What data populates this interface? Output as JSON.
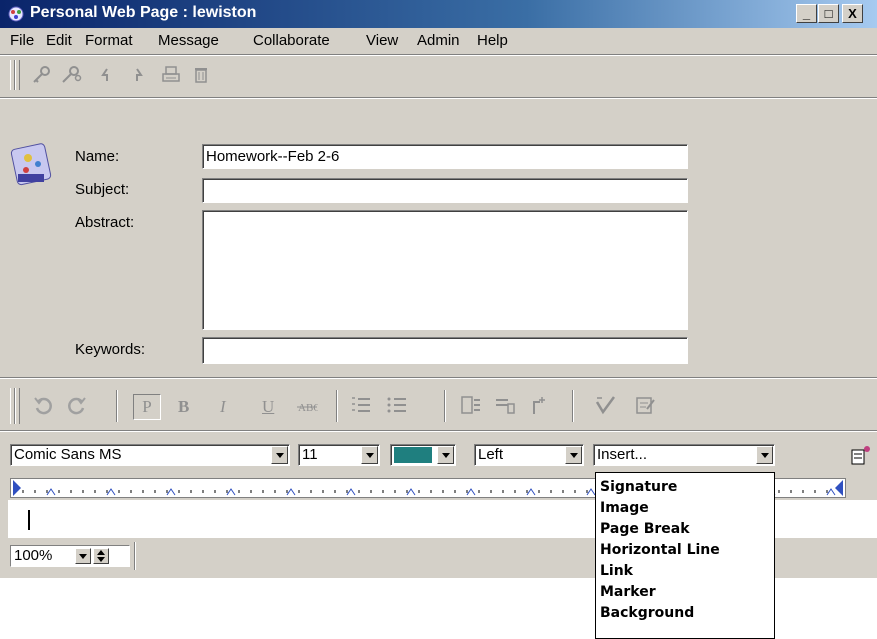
{
  "window": {
    "title": "Personal Web Page : lewiston",
    "min_label": "_",
    "max_label": "□",
    "close_label": "X"
  },
  "menu": [
    "File",
    "Edit",
    "Format",
    "Message",
    "Collaborate",
    "View",
    "Admin",
    "Help"
  ],
  "form": {
    "name_label": "Name:",
    "name_value": "Homework--Feb 2-6",
    "subject_label": "Subject:",
    "subject_value": "",
    "abstract_label": "Abstract:",
    "abstract_value": "",
    "keywords_label": "Keywords:",
    "keywords_value": ""
  },
  "format_toolbar": {
    "paragraph": "P",
    "bold": "B",
    "italic": "I",
    "underline": "U"
  },
  "formatbar": {
    "font": "Comic Sans MS",
    "size": "11",
    "color": "#1f7f7f",
    "align": "Left",
    "insert": "Insert..."
  },
  "insert_menu": [
    "Signature",
    "Image",
    "Page Break",
    "Horizontal Line",
    "Link",
    "Marker",
    "Background"
  ],
  "status": {
    "zoom": "100%"
  },
  "colors": {
    "title_start": "#0a246a",
    "title_end": "#a6caf0",
    "chrome": "#d4d0c8"
  }
}
